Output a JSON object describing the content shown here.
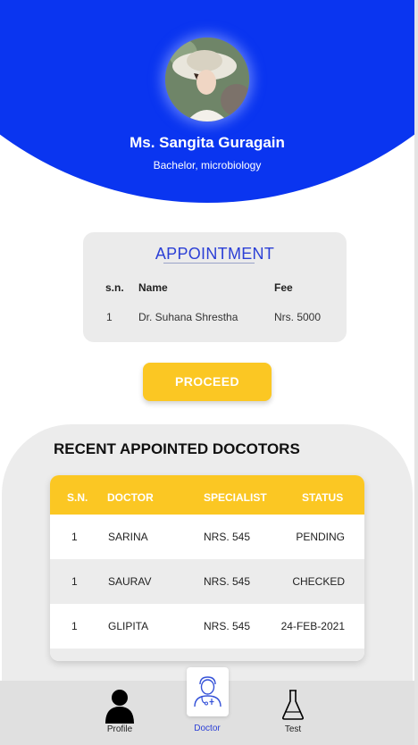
{
  "profile": {
    "name": "Ms. Sangita Guragain",
    "degree": "Bachelor, microbiology"
  },
  "appointment": {
    "title": "APPOINTMENT",
    "columns": [
      "s.n.",
      "Name",
      "Fee"
    ],
    "rows": [
      {
        "sn": "1",
        "name": "Dr. Suhana Shrestha",
        "fee": "Nrs. 5000"
      }
    ]
  },
  "proceed_label": "PROCEED",
  "recent": {
    "title": "RECENT APPOINTED DOCOTORS",
    "columns": [
      "S.N.",
      "DOCTOR",
      "SPECIALIST",
      "STATUS"
    ],
    "rows": [
      {
        "sn": "1",
        "doctor": "SARINA",
        "specialist": "NRS. 545",
        "status": "PENDING"
      },
      {
        "sn": "1",
        "doctor": "SAURAV",
        "specialist": "NRS. 545",
        "status": "CHECKED"
      },
      {
        "sn": "1",
        "doctor": "GLIPITA",
        "specialist": "NRS. 545",
        "status": "24-FEB-2021"
      }
    ]
  },
  "tabs": [
    {
      "label": "Profile",
      "icon": "person-icon"
    },
    {
      "label": "Doctor",
      "icon": "doctor-icon",
      "active": true
    },
    {
      "label": "Test",
      "icon": "flask-icon"
    }
  ],
  "colors": {
    "primary": "#0a35f0",
    "accent": "#fbc723",
    "active_tab": "#2b3fd6"
  }
}
